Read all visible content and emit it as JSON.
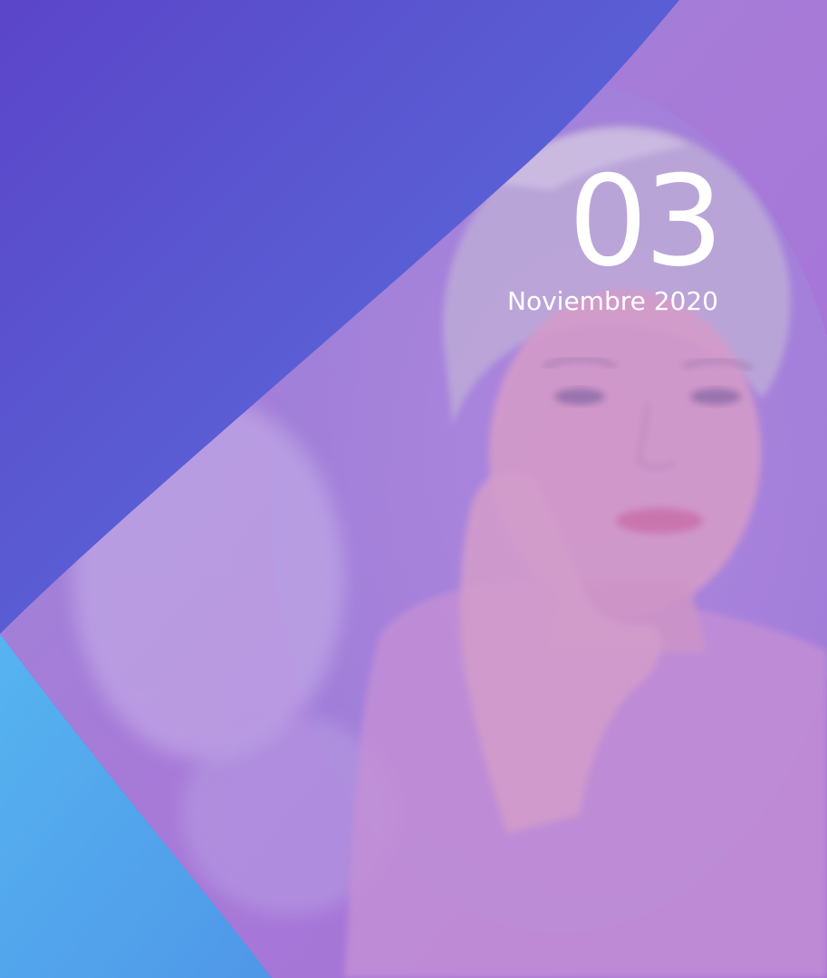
{
  "cover": {
    "day": "03",
    "month_year": "Noviembre 2020"
  },
  "colors": {
    "gradient_start": "#5b45c9",
    "gradient_end": "#5a8ee4",
    "overlay_purple": "#a77ad8",
    "bottom_blue": "#4fa8ec",
    "text": "#ffffff"
  },
  "image": {
    "subject": "woman-with-towel-touching-face-photo"
  }
}
